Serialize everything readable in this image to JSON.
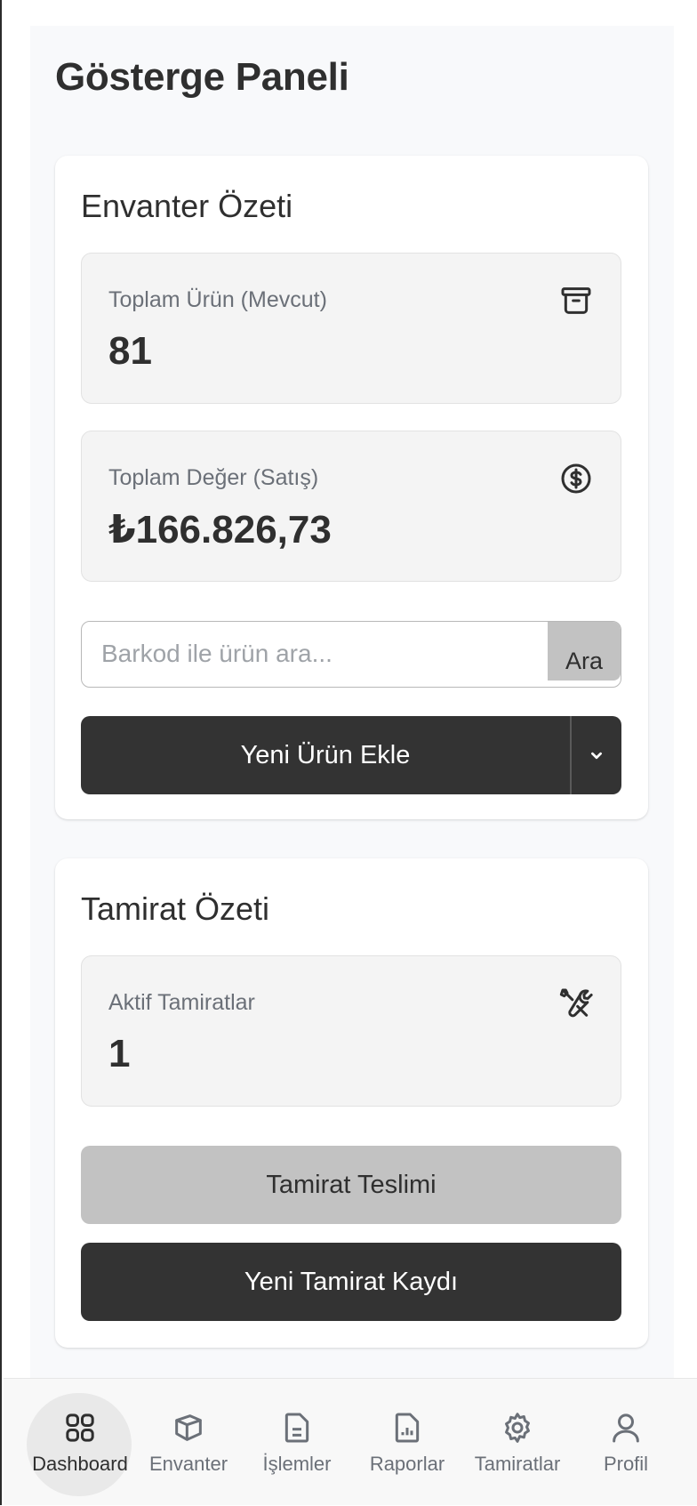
{
  "page": {
    "title": "Gösterge Paneli"
  },
  "inventory": {
    "title": "Envanter Özeti",
    "total_items": {
      "label": "Toplam Ürün (Mevcut)",
      "value": "81",
      "icon": "archive-icon"
    },
    "total_value": {
      "label": "Toplam Değer (Satış)",
      "value": "₺166.826,73",
      "icon": "dollar-circle-icon"
    },
    "search": {
      "placeholder": "Barkod ile ürün ara...",
      "value": "",
      "button_label": "Ara"
    },
    "add_button_label": "Yeni Ürün Ekle"
  },
  "repair": {
    "title": "Tamirat Özeti",
    "active": {
      "label": "Aktif Tamiratlar",
      "value": "1",
      "icon": "tools-icon"
    },
    "deliver_button_label": "Tamirat Teslimi",
    "new_button_label": "Yeni Tamirat Kaydı"
  },
  "nav": {
    "items": [
      {
        "label": "Dashboard",
        "icon": "grid-icon",
        "active": true
      },
      {
        "label": "Envanter",
        "icon": "box-icon",
        "active": false
      },
      {
        "label": "İşlemler",
        "icon": "document-icon",
        "active": false
      },
      {
        "label": "Raporlar",
        "icon": "report-icon",
        "active": false
      },
      {
        "label": "Tamiratlar",
        "icon": "gear-icon",
        "active": false
      },
      {
        "label": "Profil",
        "icon": "user-icon",
        "active": false
      }
    ]
  },
  "colors": {
    "dark_button": "#333333",
    "light_button": "#c2c2c2",
    "card_bg": "#ffffff",
    "stat_bg": "#f4f4f4",
    "muted_text": "#6b7078"
  }
}
